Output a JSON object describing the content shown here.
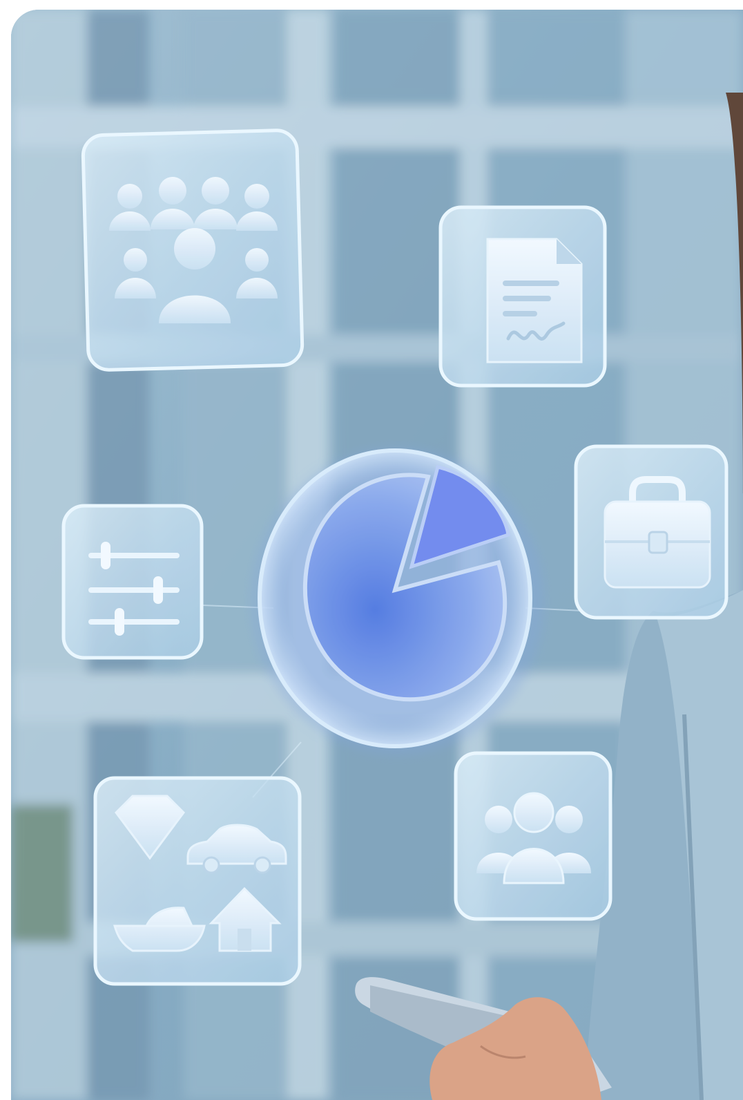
{
  "image": {
    "description_tags": [
      "floating-glass-icons",
      "office-window-background",
      "person-holding-phone"
    ],
    "accent_colors": {
      "glass_fill": "#cfe6f5",
      "glass_edge": "#e8f6ff",
      "pie_primary": "#6d92e6",
      "pie_slice": "#7f8ff0",
      "window_dark": "#5f87a3",
      "window_light": "#b9d3e2",
      "jacket": "#8fb0c8",
      "skin": "#d8a48a"
    }
  },
  "icons": [
    {
      "name": "team-group-icon"
    },
    {
      "name": "signed-document-icon"
    },
    {
      "name": "pie-chart-icon"
    },
    {
      "name": "settings-sliders-icon"
    },
    {
      "name": "briefcase-icon"
    },
    {
      "name": "assets-icon"
    },
    {
      "name": "users-icon"
    }
  ]
}
